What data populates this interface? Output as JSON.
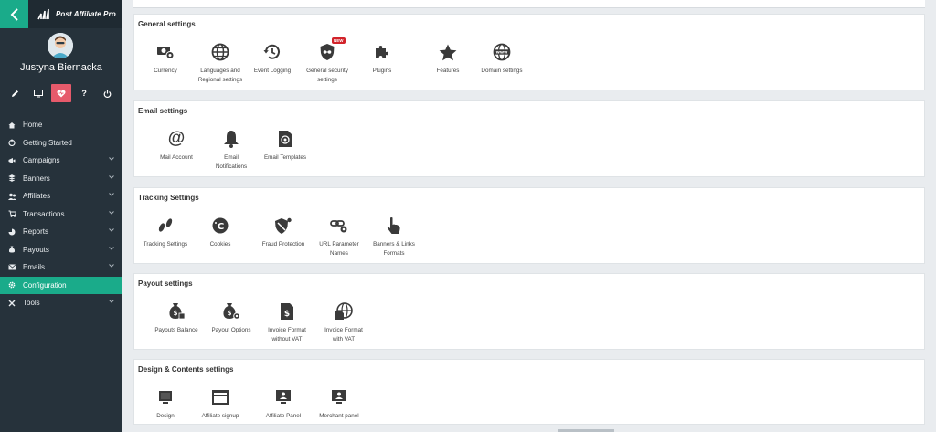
{
  "app": {
    "logo_text": "Post Affiliate Pro"
  },
  "user": {
    "name": "Justyna Biernacka"
  },
  "profile_actions": [
    {
      "icon": "pencil-icon"
    },
    {
      "icon": "monitor-icon"
    },
    {
      "icon": "heart-icon",
      "active": true
    },
    {
      "icon": "help-icon"
    },
    {
      "icon": "power-icon"
    }
  ],
  "nav": [
    {
      "label": "Home",
      "icon": "home-icon",
      "has_children": false
    },
    {
      "label": "Getting Started",
      "icon": "getting-started-icon",
      "has_children": false
    },
    {
      "label": "Campaigns",
      "icon": "campaigns-icon",
      "has_children": true
    },
    {
      "label": "Banners",
      "icon": "banners-icon",
      "has_children": true
    },
    {
      "label": "Affiliates",
      "icon": "affiliates-icon",
      "has_children": true
    },
    {
      "label": "Transactions",
      "icon": "transactions-icon",
      "has_children": true
    },
    {
      "label": "Reports",
      "icon": "reports-icon",
      "has_children": true
    },
    {
      "label": "Payouts",
      "icon": "payouts-icon",
      "has_children": true
    },
    {
      "label": "Emails",
      "icon": "emails-icon",
      "has_children": true
    },
    {
      "label": "Configuration",
      "icon": "configuration-icon",
      "has_children": false,
      "active": true
    },
    {
      "label": "Tools",
      "icon": "tools-icon",
      "has_children": true
    }
  ],
  "sections": [
    {
      "title": "General settings",
      "items": [
        {
          "label": "Currency",
          "icon": "currency-icon"
        },
        {
          "label": "Languages and\nRegional settings",
          "icon": "globe-icon"
        },
        {
          "label": "Event Logging",
          "icon": "event-logging-icon"
        },
        {
          "label": "General security\nsettings",
          "icon": "security-icon",
          "badge": "NEW"
        },
        {
          "label": "Plugins",
          "icon": "puzzle-icon"
        },
        {
          "label": "Features",
          "icon": "star-icon"
        },
        {
          "label": "Domain settings",
          "icon": "www-globe-icon"
        }
      ]
    },
    {
      "title": "Email settings",
      "items": [
        {
          "label": "Mail Account",
          "icon": "at-icon"
        },
        {
          "label": "Email\nNotifications",
          "icon": "bell-icon"
        },
        {
          "label": "Email Templates",
          "icon": "email-template-icon"
        }
      ]
    },
    {
      "title": "Tracking Settings",
      "items": [
        {
          "label": "Tracking Settings",
          "icon": "footprints-icon"
        },
        {
          "label": "Cookies",
          "icon": "cookie-icon"
        },
        {
          "label": "Fraud Protection",
          "icon": "fraud-icon"
        },
        {
          "label": "URL Parameter\nNames",
          "icon": "url-parameter-icon"
        },
        {
          "label": "Banners & Links\nFormats",
          "icon": "pointer-hand-icon"
        }
      ]
    },
    {
      "title": "Payout settings",
      "items": [
        {
          "label": "Payouts Balance",
          "icon": "payouts-balance-icon"
        },
        {
          "label": "Payout Options",
          "icon": "payout-options-icon"
        },
        {
          "label": "Invoice Format\nwithout VAT",
          "icon": "invoice-icon"
        },
        {
          "label": "Invoice Format\nwith VAT",
          "icon": "invoice-vat-icon"
        }
      ]
    },
    {
      "title": "Design & Contents settings",
      "items": [
        {
          "label": "Design",
          "icon": "monitor-icon"
        },
        {
          "label": "Affiliate signup",
          "icon": "signup-form-icon"
        },
        {
          "label": "Affiliate Panel",
          "icon": "affiliate-panel-icon"
        },
        {
          "label": "Merchant panel",
          "icon": "merchant-panel-icon"
        }
      ]
    }
  ],
  "colors": {
    "accent": "#1aab8a",
    "sidebar": "#26323b",
    "badge": "#d2232a",
    "active_action": "#e65a6b"
  }
}
